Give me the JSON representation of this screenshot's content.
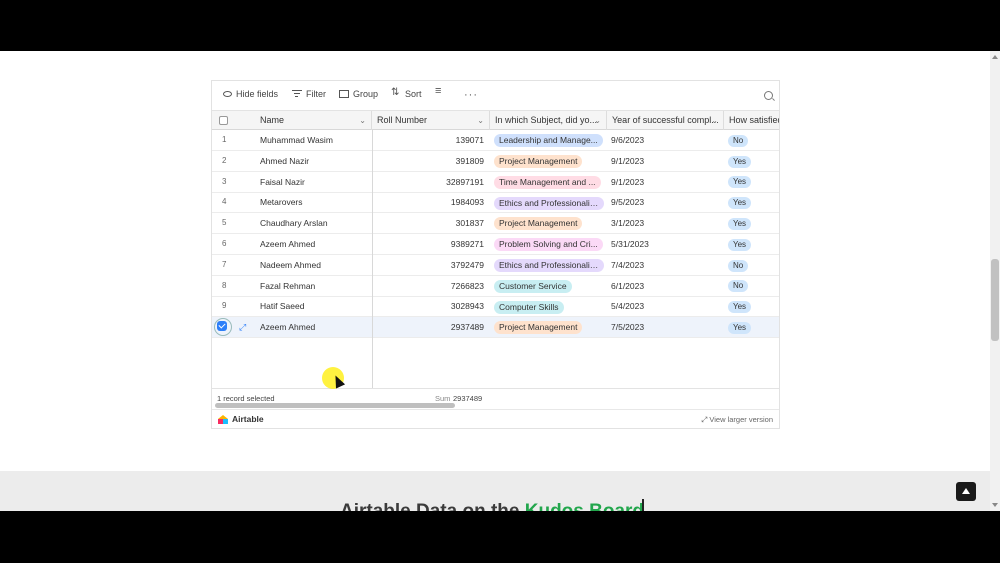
{
  "toolbar": {
    "hide_fields": "Hide fields",
    "filter": "Filter",
    "group": "Group",
    "sort": "Sort",
    "more": "···"
  },
  "columns": {
    "name": "Name",
    "roll": "Roll Number",
    "subject": "In which Subject, did yo...",
    "year": "Year of successful compl...",
    "satisfied": "How satisfied"
  },
  "rows": [
    {
      "num": "1",
      "name": "Muhammad Wasim",
      "roll": "139071",
      "subject": "Leadership and Manage...",
      "subject_color": "#cfe0fc",
      "date": "9/6/2023",
      "satisfied": "No"
    },
    {
      "num": "2",
      "name": "Ahmed Nazir",
      "roll": "391809",
      "subject": "Project Management",
      "subject_color": "#fee2cd",
      "date": "9/1/2023",
      "satisfied": "Yes"
    },
    {
      "num": "3",
      "name": "Faisal Nazir",
      "roll": "32897191",
      "subject": "Time Management and ...",
      "subject_color": "#ffdce5",
      "date": "9/1/2023",
      "satisfied": "Yes"
    },
    {
      "num": "4",
      "name": "Metarovers",
      "roll": "1984093",
      "subject": "Ethics and Professionalism",
      "subject_color": "#e4d9fc",
      "date": "9/5/2023",
      "satisfied": "Yes"
    },
    {
      "num": "5",
      "name": "Chaudhary Arslan",
      "roll": "301837",
      "subject": "Project Management",
      "subject_color": "#fee2cd",
      "date": "3/1/2023",
      "satisfied": "Yes"
    },
    {
      "num": "6",
      "name": "Azeem Ahmed",
      "roll": "9389271",
      "subject": "Problem Solving and Cri...",
      "subject_color": "#fbd9f6",
      "date": "5/31/2023",
      "satisfied": "Yes"
    },
    {
      "num": "7",
      "name": "Nadeem Ahmed",
      "roll": "3792479",
      "subject": "Ethics and Professionalism",
      "subject_color": "#e4d9fc",
      "date": "7/4/2023",
      "satisfied": "No"
    },
    {
      "num": "8",
      "name": "Fazal Rehman",
      "roll": "7266823",
      "subject": "Customer Service",
      "subject_color": "#c8eef2",
      "date": "6/1/2023",
      "satisfied": "No"
    },
    {
      "num": "9",
      "name": "Hatif Saeed",
      "roll": "3028943",
      "subject": "Computer Skills",
      "subject_color": "#c8eef2",
      "date": "5/4/2023",
      "satisfied": "Yes"
    },
    {
      "num": "",
      "name": "Azeem Ahmed",
      "roll": "2937489",
      "subject": "Project Management",
      "subject_color": "#fee2cd",
      "date": "7/5/2023",
      "satisfied": "Yes",
      "selected": true
    }
  ],
  "footer": {
    "selected": "1 record selected",
    "sum_label": "Sum",
    "sum_value": "2937489"
  },
  "brand": {
    "name": "Airtable",
    "view_larger": "View larger version"
  },
  "section": {
    "heading_part1": "Airtable Data on the ",
    "heading_part2": "Kudos Board"
  }
}
